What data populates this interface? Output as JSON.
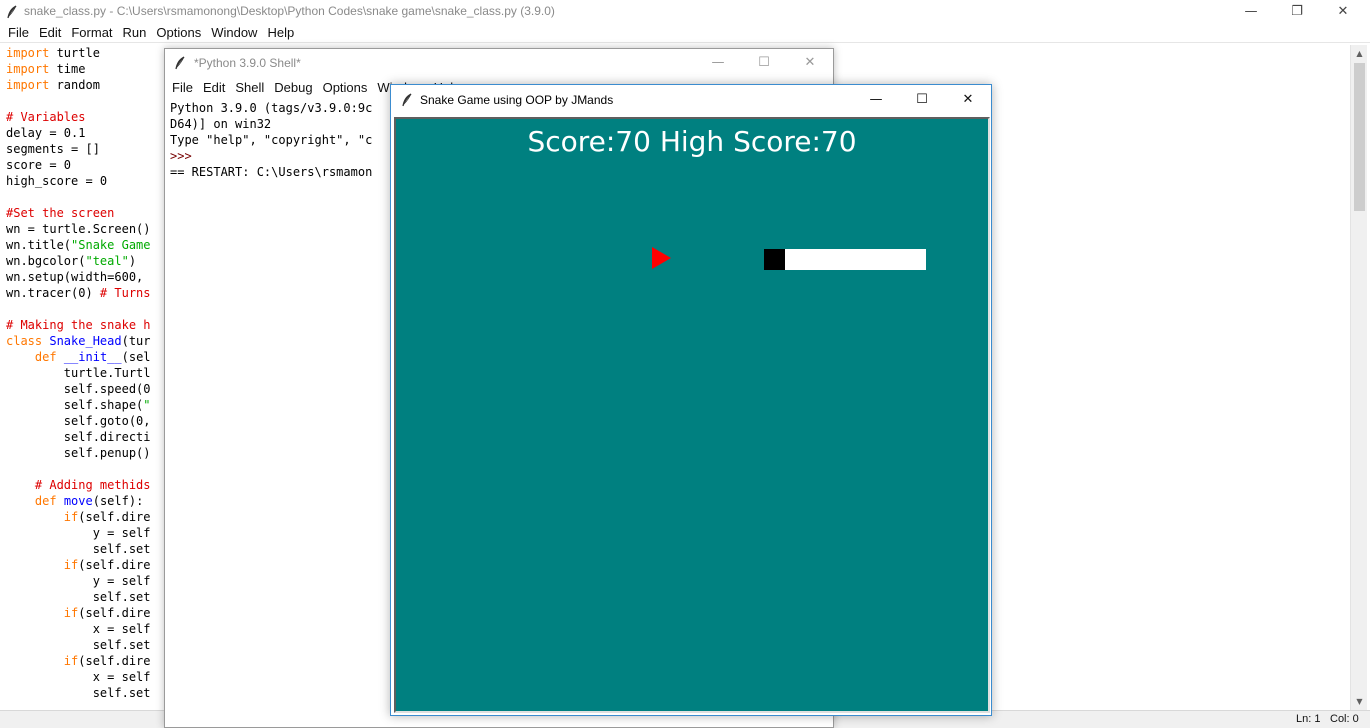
{
  "editor": {
    "title": "snake_class.py - C:\\Users\\rsmamonong\\Desktop\\Python Codes\\snake game\\snake_class.py (3.9.0)",
    "menu": [
      "File",
      "Edit",
      "Format",
      "Run",
      "Options",
      "Window",
      "Help"
    ],
    "code_lines": [
      [
        {
          "t": "import",
          "c": "kw"
        },
        {
          "t": " turtle"
        }
      ],
      [
        {
          "t": "import",
          "c": "kw"
        },
        {
          "t": " time"
        }
      ],
      [
        {
          "t": "import",
          "c": "kw"
        },
        {
          "t": " random"
        }
      ],
      [],
      [
        {
          "t": "# Variables",
          "c": "cm"
        }
      ],
      [
        {
          "t": "delay = 0.1"
        }
      ],
      [
        {
          "t": "segments = []"
        }
      ],
      [
        {
          "t": "score = 0"
        }
      ],
      [
        {
          "t": "high_score = 0"
        }
      ],
      [],
      [
        {
          "t": "#Set the screen",
          "c": "cm"
        }
      ],
      [
        {
          "t": "wn = turtle.Screen()"
        }
      ],
      [
        {
          "t": "wn.title("
        },
        {
          "t": "\"Snake Game",
          "c": "st"
        }
      ],
      [
        {
          "t": "wn.bgcolor("
        },
        {
          "t": "\"teal\"",
          "c": "st"
        },
        {
          "t": ")"
        }
      ],
      [
        {
          "t": "wn.setup(width=600,"
        }
      ],
      [
        {
          "t": "wn.tracer(0) "
        },
        {
          "t": "# Turns",
          "c": "cm"
        }
      ],
      [],
      [
        {
          "t": "# Making the snake h",
          "c": "cm"
        }
      ],
      [
        {
          "t": "class",
          "c": "kw"
        },
        {
          "t": " "
        },
        {
          "t": "Snake_Head",
          "c": "df"
        },
        {
          "t": "(tur"
        }
      ],
      [
        {
          "t": "    "
        },
        {
          "t": "def",
          "c": "kw"
        },
        {
          "t": " "
        },
        {
          "t": "__init__",
          "c": "df"
        },
        {
          "t": "(sel"
        }
      ],
      [
        {
          "t": "        turtle.Turtl"
        }
      ],
      [
        {
          "t": "        self.speed(0"
        }
      ],
      [
        {
          "t": "        self.shape("
        },
        {
          "t": "\"",
          "c": "st"
        }
      ],
      [
        {
          "t": "        self.goto(0,"
        }
      ],
      [
        {
          "t": "        self.directi"
        }
      ],
      [
        {
          "t": "        self.penup()"
        }
      ],
      [],
      [
        {
          "t": "    "
        },
        {
          "t": "# Adding methids",
          "c": "cm"
        }
      ],
      [
        {
          "t": "    "
        },
        {
          "t": "def",
          "c": "kw"
        },
        {
          "t": " "
        },
        {
          "t": "move",
          "c": "df"
        },
        {
          "t": "(self):"
        }
      ],
      [
        {
          "t": "        "
        },
        {
          "t": "if",
          "c": "kw"
        },
        {
          "t": "(self.dire"
        }
      ],
      [
        {
          "t": "            y = self"
        }
      ],
      [
        {
          "t": "            self.set"
        }
      ],
      [
        {
          "t": "        "
        },
        {
          "t": "if",
          "c": "kw"
        },
        {
          "t": "(self.dire"
        }
      ],
      [
        {
          "t": "            y = self"
        }
      ],
      [
        {
          "t": "            self.set"
        }
      ],
      [
        {
          "t": "        "
        },
        {
          "t": "if",
          "c": "kw"
        },
        {
          "t": "(self.dire"
        }
      ],
      [
        {
          "t": "            x = self"
        }
      ],
      [
        {
          "t": "            self.set"
        }
      ],
      [
        {
          "t": "        "
        },
        {
          "t": "if",
          "c": "kw"
        },
        {
          "t": "(self.dire"
        }
      ],
      [
        {
          "t": "            x = self"
        }
      ],
      [
        {
          "t": "            self.set"
        }
      ]
    ],
    "status": {
      "ln": "Ln: 1",
      "col": "Col: 0"
    }
  },
  "shell": {
    "title": "*Python 3.9.0 Shell*",
    "menu": [
      "File",
      "Edit",
      "Shell",
      "Debug",
      "Options",
      "Window",
      "Help"
    ],
    "lines": [
      {
        "t": "Python 3.9.0 (tags/v3.9.0:9c"
      },
      {
        "t": "D64)] on win32"
      },
      {
        "t": "Type \"help\", \"copyright\", \"c"
      },
      {
        "t": ">>>",
        "c": "prompt"
      },
      {
        "t": "== RESTART: C:\\Users\\rsmamon"
      }
    ]
  },
  "turtle_window": {
    "title": "Snake Game using OOP by JMands",
    "score_text": "Score:70 High Score:70",
    "canvas_color": "#008080",
    "snake_head_color": "#000000",
    "snake_body_color": "#ffffff",
    "food_color": "#ff0000",
    "food_shape": "triangle"
  },
  "window_controls": {
    "minimize": "—",
    "maximize": "☐",
    "restore": "❐",
    "close": "✕"
  }
}
